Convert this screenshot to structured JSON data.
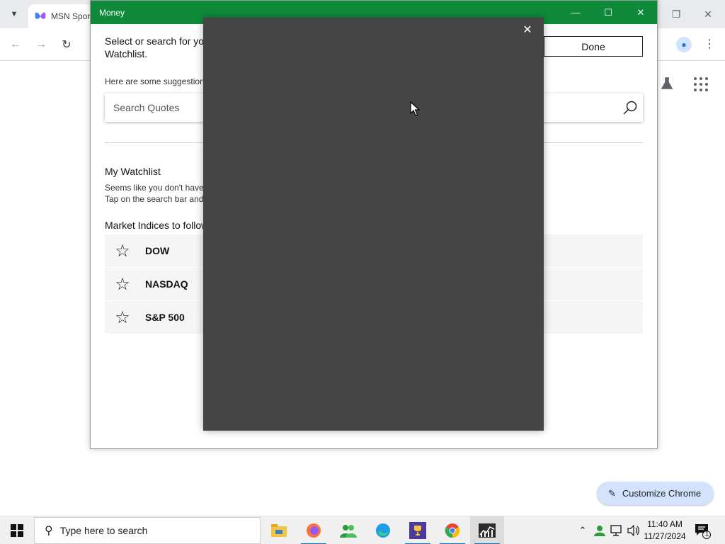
{
  "chrome": {
    "tab_title": "MSN Sports",
    "customize_label": "Customize Chrome"
  },
  "money": {
    "window_title": "Money",
    "instruction": "Select or search for your Watchlist.",
    "done_label": "Done",
    "suggestions_text": "Here are some suggestions",
    "search_placeholder": "Search Quotes",
    "watchlist_heading": "My Watchlist",
    "watchlist_empty_line1": "Seems like you don't have",
    "watchlist_empty_line2": "Tap on the search bar and",
    "indices_heading": "Market Indices to follow",
    "indices": [
      {
        "name": "DOW"
      },
      {
        "name": "NASDAQ"
      },
      {
        "name": "S&P 500"
      }
    ]
  },
  "taskbar": {
    "search_placeholder": "Type here to search",
    "time": "11:40 AM",
    "date": "11/27/2024",
    "notification_count": "1"
  },
  "colors": {
    "money_titlebar": "#0f8a3a",
    "overlay": "#454545",
    "accent": "#0078d4"
  }
}
